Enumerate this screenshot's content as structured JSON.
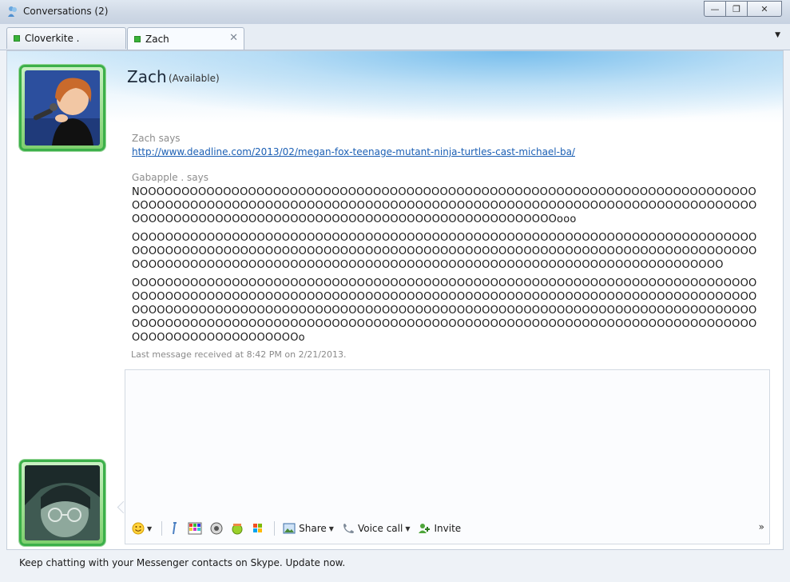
{
  "window": {
    "title": "Conversations (2)",
    "controls": {
      "minimize": "—",
      "maximize": "❐",
      "close": "✕"
    }
  },
  "tabs": [
    {
      "label": "Cloverkite .",
      "presence_color": "#39b338"
    },
    {
      "label": "Zach",
      "presence_color": "#39b338",
      "close": "✕",
      "active": true
    }
  ],
  "tab_dropdown": "▼",
  "contact": {
    "name": "Zach",
    "status": "(Available)"
  },
  "messages": [
    {
      "sender": "Zach says",
      "link": "http://www.deadline.com/2013/02/megan-fox-teenage-mutant-ninja-turtles-cast-michael-ba/"
    },
    {
      "sender": "Gabapple . says",
      "blocks": [
        [
          "NOOOOOOOOOOOOOOOOOOOOOOOOOOOOOOOOOOOOOOOOOOOOOOOOOOOOOOOOOOOOOOOOOOOOOOOOOO",
          "OOOOOOOOOOOOOOOOOOOOOOOOOOOOOOOOOOOOOOOOOOOOOOOOOOOOOOOOOOOOOOOOOOOOOOOOOOO",
          "OOOOOOOOOOOOOOOOOOOOOOOOOOOOOOOOOOOOOOOOOOOOOOOOOOOooo"
        ],
        [
          "OOOOOOOOOOOOOOOOOOOOOOOOOOOOOOOOOOOOOOOOOOOOOOOOOOOOOOOOOOOOOOOOOOOOOOOOOOO",
          "OOOOOOOOOOOOOOOOOOOOOOOOOOOOOOOOOOOOOOOOOOOOOOOOOOOOOOOOOOOOOOOOOOOOOOOOOOO",
          "OOOOOOOOOOOOOOOOOOOOOOOOOOOOOOOOOOOOOOOOOOOOOOOOOOOOOOOOOOOOOOOOOOOOOOO"
        ],
        [
          "OOOOOOOOOOOOOOOOOOOOOOOOOOOOOOOOOOOOOOOOOOOOOOOOOOOOOOOOOOOOOOOOOOOOOOOOOOO",
          "OOOOOOOOOOOOOOOOOOOOOOOOOOOOOOOOOOOOOOOOOOOOOOOOOOOOOOOOOOOOOOOOOOOOOOOOOOO",
          "OOOOOOOOOOOOOOOOOOOOOOOOOOOOOOOOOOOOOOOOOOOOOOOOOOOOOOOOOOOOOOOOOOOOOOOOOOO",
          "OOOOOOOOOOOOOOOOOOOOOOOOOOOOOOOOOOOOOOOOOOOOOOOOOOOOOOOOOOOOOOOOOOOOOOOOOOO",
          "OOOOOOOOOOOOOOOOOOOOo"
        ]
      ]
    }
  ],
  "last_received": "Last message received at 8:42 PM on 2/21/2013.",
  "toolbar": {
    "share": "Share",
    "voice_call": "Voice call",
    "invite": "Invite",
    "more": "»"
  },
  "update_notice": "Keep chatting with your Messenger contacts on Skype. Update now.",
  "colors": {
    "presence_online": "#39b338",
    "avatar_frame": "#3cb04a",
    "link": "#1b5fb4"
  }
}
